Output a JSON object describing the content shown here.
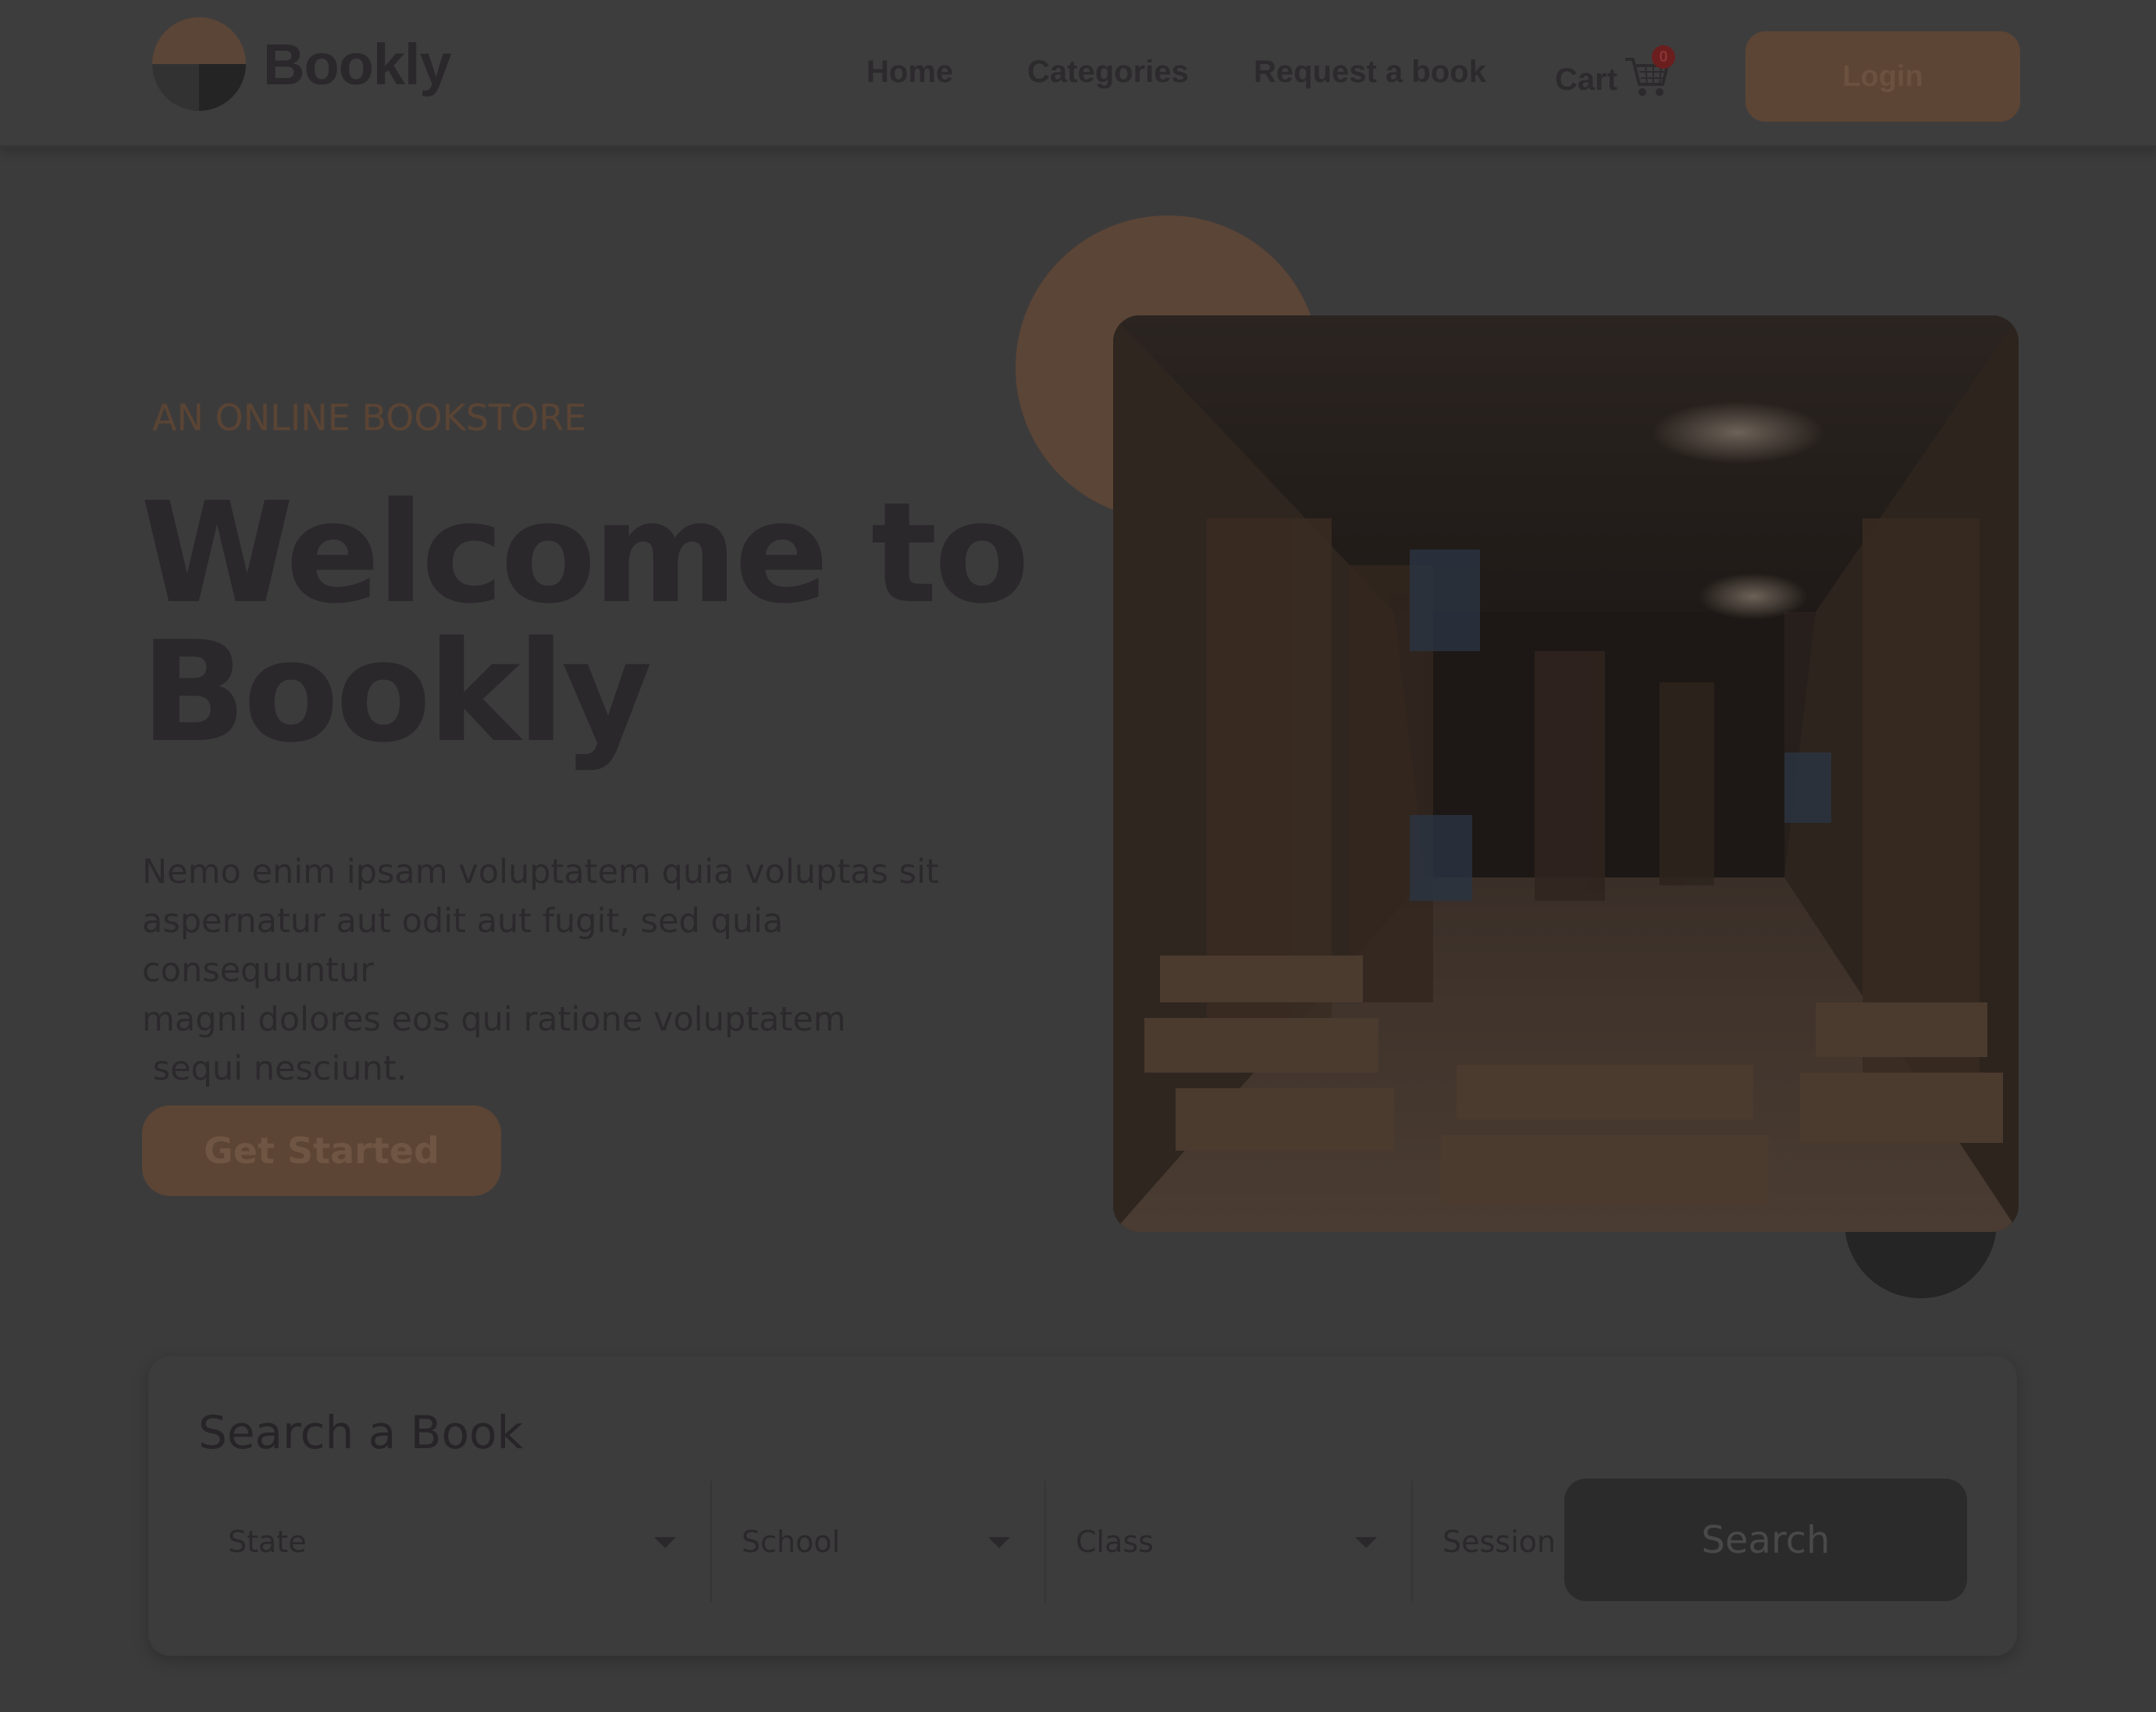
{
  "nav": {
    "brand_name": "Bookly",
    "links": {
      "home": "Home",
      "categories": "Categories",
      "request": "Request a book",
      "cart": "Cart"
    },
    "cart_count": "0",
    "login_label": "Login"
  },
  "hero": {
    "eyebrow": "AN ONLINE BOOKSTORE",
    "title_line1": "Welcome to",
    "title_line2": "Bookly",
    "description_lines": [
      "Nemo enim ipsam voluptatem quia voluptas sit",
      "aspernatur aut odit aut fugit, sed quia consequuntur",
      "magni dolores eos qui ratione voluptatem",
      " sequi nesciunt."
    ],
    "cta_label": "Get Started"
  },
  "search": {
    "title": "Search a Book",
    "fields": {
      "state": "State",
      "school": "School",
      "class": "Class",
      "session": "Session"
    },
    "button_label": "Search"
  },
  "colors": {
    "accent": "#e28a3b",
    "accent_dimmed": "#5c4535",
    "overlay_background": "#3c3b3c",
    "dark_button": "#2c2b2c"
  },
  "icons": {
    "logo": "bookly-logo-icon",
    "cart": "shopping-cart-icon",
    "dropdown": "caret-down-icon"
  }
}
